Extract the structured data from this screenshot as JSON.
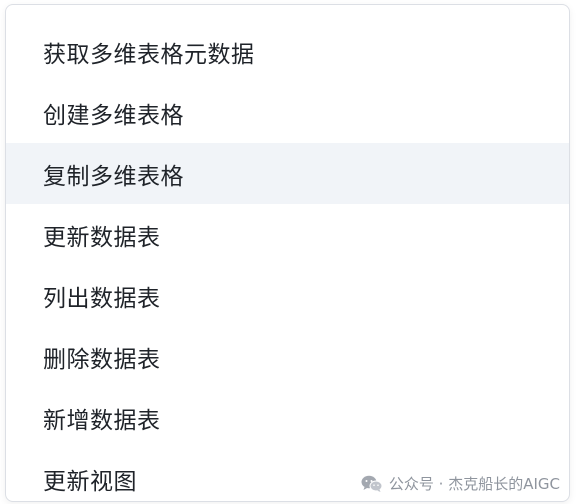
{
  "menu": {
    "items": [
      {
        "label": "获取多维表格元数据"
      },
      {
        "label": "创建多维表格"
      },
      {
        "label": "复制多维表格",
        "highlighted": true
      },
      {
        "label": "更新数据表"
      },
      {
        "label": "列出数据表"
      },
      {
        "label": "删除数据表"
      },
      {
        "label": "新增数据表"
      },
      {
        "label": "更新视图"
      }
    ]
  },
  "watermark": {
    "text": "公众号 · 杰克船长的AIGC",
    "icon": "wechat-icon"
  },
  "colors": {
    "text": "#1f2329",
    "hover_bg": "#f1f4f8",
    "border": "#dcdfe5",
    "watermark": "#8f959e"
  }
}
